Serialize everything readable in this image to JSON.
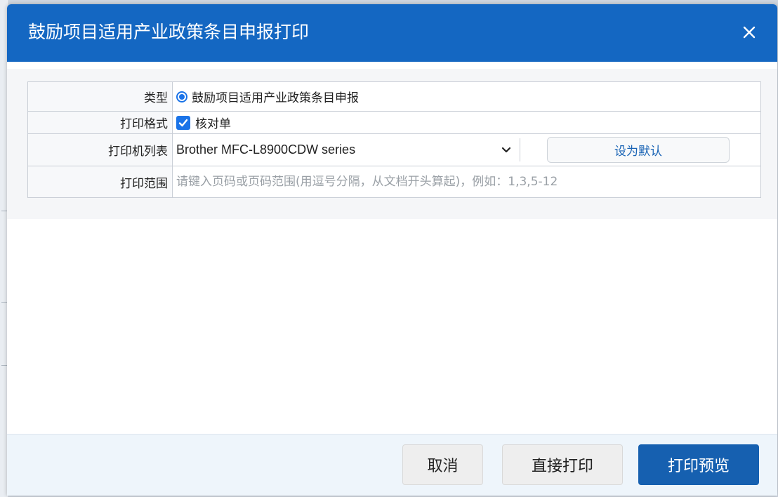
{
  "dialog": {
    "title": "鼓励项目适用产业政策条目申报打印",
    "close_icon": "close-icon"
  },
  "form": {
    "type": {
      "label": "类型",
      "option": "鼓励项目适用产业政策条目申报",
      "selected": true
    },
    "format": {
      "label": "打印格式",
      "option": "核对单",
      "checked": true
    },
    "printer": {
      "label": "打印机列表",
      "selected": "Brother MFC-L8900CDW series",
      "set_default": "设为默认"
    },
    "range": {
      "label": "打印范围",
      "placeholder": "请键入页码或页码范围(用逗号分隔，从文档开头算起)，例如：1,3,5-12",
      "value": ""
    }
  },
  "footer": {
    "cancel": "取消",
    "direct_print": "直接打印",
    "print_preview": "打印预览"
  },
  "colors": {
    "title_bar": "#1467c2",
    "primary_button": "#1660b0",
    "accent": "#1a73e8"
  }
}
